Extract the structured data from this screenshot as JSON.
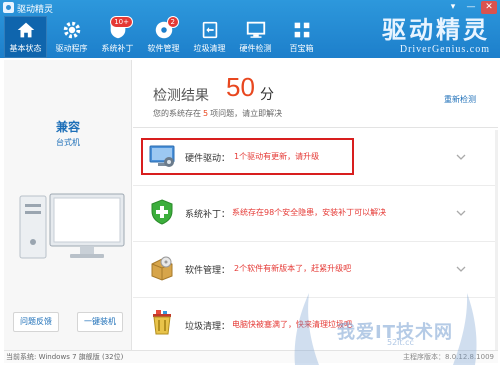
{
  "window": {
    "title": "驱动精灵",
    "controls": [
      "▾",
      "—",
      "✕"
    ]
  },
  "nav": {
    "items": [
      {
        "label": "基本状态",
        "icon": "home-icon",
        "active": true
      },
      {
        "label": "驱动程序",
        "icon": "gear-icon"
      },
      {
        "label": "系统补丁",
        "icon": "shield-icon",
        "badge": "10+"
      },
      {
        "label": "软件管理",
        "icon": "disc-icon",
        "badge": "2"
      },
      {
        "label": "垃圾清理",
        "icon": "trash-icon"
      },
      {
        "label": "硬件检测",
        "icon": "monitor-icon"
      },
      {
        "label": "百宝箱",
        "icon": "toolbox-icon"
      }
    ]
  },
  "brand": {
    "name_cn": "驱动精灵",
    "name_en": "DriverGenius.com"
  },
  "left": {
    "compat_title": "兼容",
    "compat_sub": "台式机",
    "feedback_label": "问题反馈",
    "install_label": "一键装机"
  },
  "result": {
    "label": "检测结果",
    "score": "50",
    "score_unit": "分",
    "desc_prefix": "您的系统存在",
    "problem_count": "5",
    "desc_suffix": "项问题，请立即解决",
    "recheck_label": "重新检测"
  },
  "items": [
    {
      "name": "硬件驱动：",
      "desc": "1个驱动有更新，请升级",
      "icon": "hardware-driver-icon"
    },
    {
      "name": "系统补丁：",
      "desc": "系统存在98个安全隐患，安装补丁可以解决",
      "icon": "shield-check-icon"
    },
    {
      "name": "软件管理：",
      "desc": "2个软件有新版本了，赶紧升级吧",
      "icon": "software-box-icon"
    },
    {
      "name": "垃圾清理：",
      "desc": "电脑快被塞满了，快来清理垃圾吧",
      "icon": "trash-bin-icon"
    }
  ],
  "status": {
    "os_label": "当前系统:",
    "os_value": "Windows 7 旗舰版 (32位)",
    "version_label": "主程序版本：",
    "version_value": "8.0.12.8.1009"
  },
  "watermark": {
    "text": "我爱IT技术网",
    "sub": "52it.cc"
  },
  "colors": {
    "accent_blue": "#1d7fcb",
    "score_red": "#e8471f",
    "highlight_red": "#d81e1e",
    "link_blue": "#1d6fb8"
  }
}
